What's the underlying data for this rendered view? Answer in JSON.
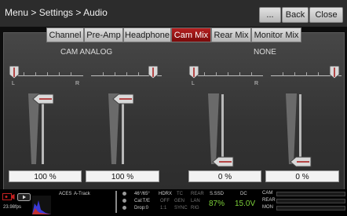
{
  "header": {
    "title": "Menu > Settings > Audio",
    "more_label": "...",
    "back_label": "Back",
    "close_label": "Close"
  },
  "tabs": [
    {
      "label": "Channel",
      "active": false
    },
    {
      "label": "Pre-Amp",
      "active": false
    },
    {
      "label": "Headphone",
      "active": false
    },
    {
      "label": "Cam Mix",
      "active": true
    },
    {
      "label": "Rear Mix",
      "active": false
    },
    {
      "label": "Monitor Mix",
      "active": false
    }
  ],
  "groups": [
    {
      "label": "CAM ANALOG"
    },
    {
      "label": "NONE"
    }
  ],
  "pan_label_left": "L",
  "pan_label_right": "R",
  "channels": [
    {
      "level": "100 %",
      "level_fraction": 1.0
    },
    {
      "level": "100 %",
      "level_fraction": 1.0
    },
    {
      "level": "0 %",
      "level_fraction": 0.0
    },
    {
      "level": "0 %",
      "level_fraction": 0.0
    }
  ],
  "colors": {
    "accent": "#a81414",
    "active_tab": "#9b1010",
    "green_readout": "#7dd13a"
  },
  "status": {
    "fps": "23.98fps",
    "color_pipeline": "ACES",
    "audio_track": "A-Track",
    "shutter": "46°/65°",
    "cal": "Cal:T/E",
    "drop": "Drop:0",
    "hdrx": "HDRX",
    "hdrx_off": "OFF",
    "ratio": "1:1",
    "tc": "TC",
    "gen": "GEN",
    "sync": "SYNC",
    "rear": "REAR",
    "lan": "LAN",
    "rig": "RIG",
    "media": "S.SSD",
    "media_pct": "87%",
    "power": "DC",
    "voltage": "15.0V",
    "meter_cam": "CAM",
    "meter_rear": "REAR",
    "meter_mon": "MON"
  }
}
